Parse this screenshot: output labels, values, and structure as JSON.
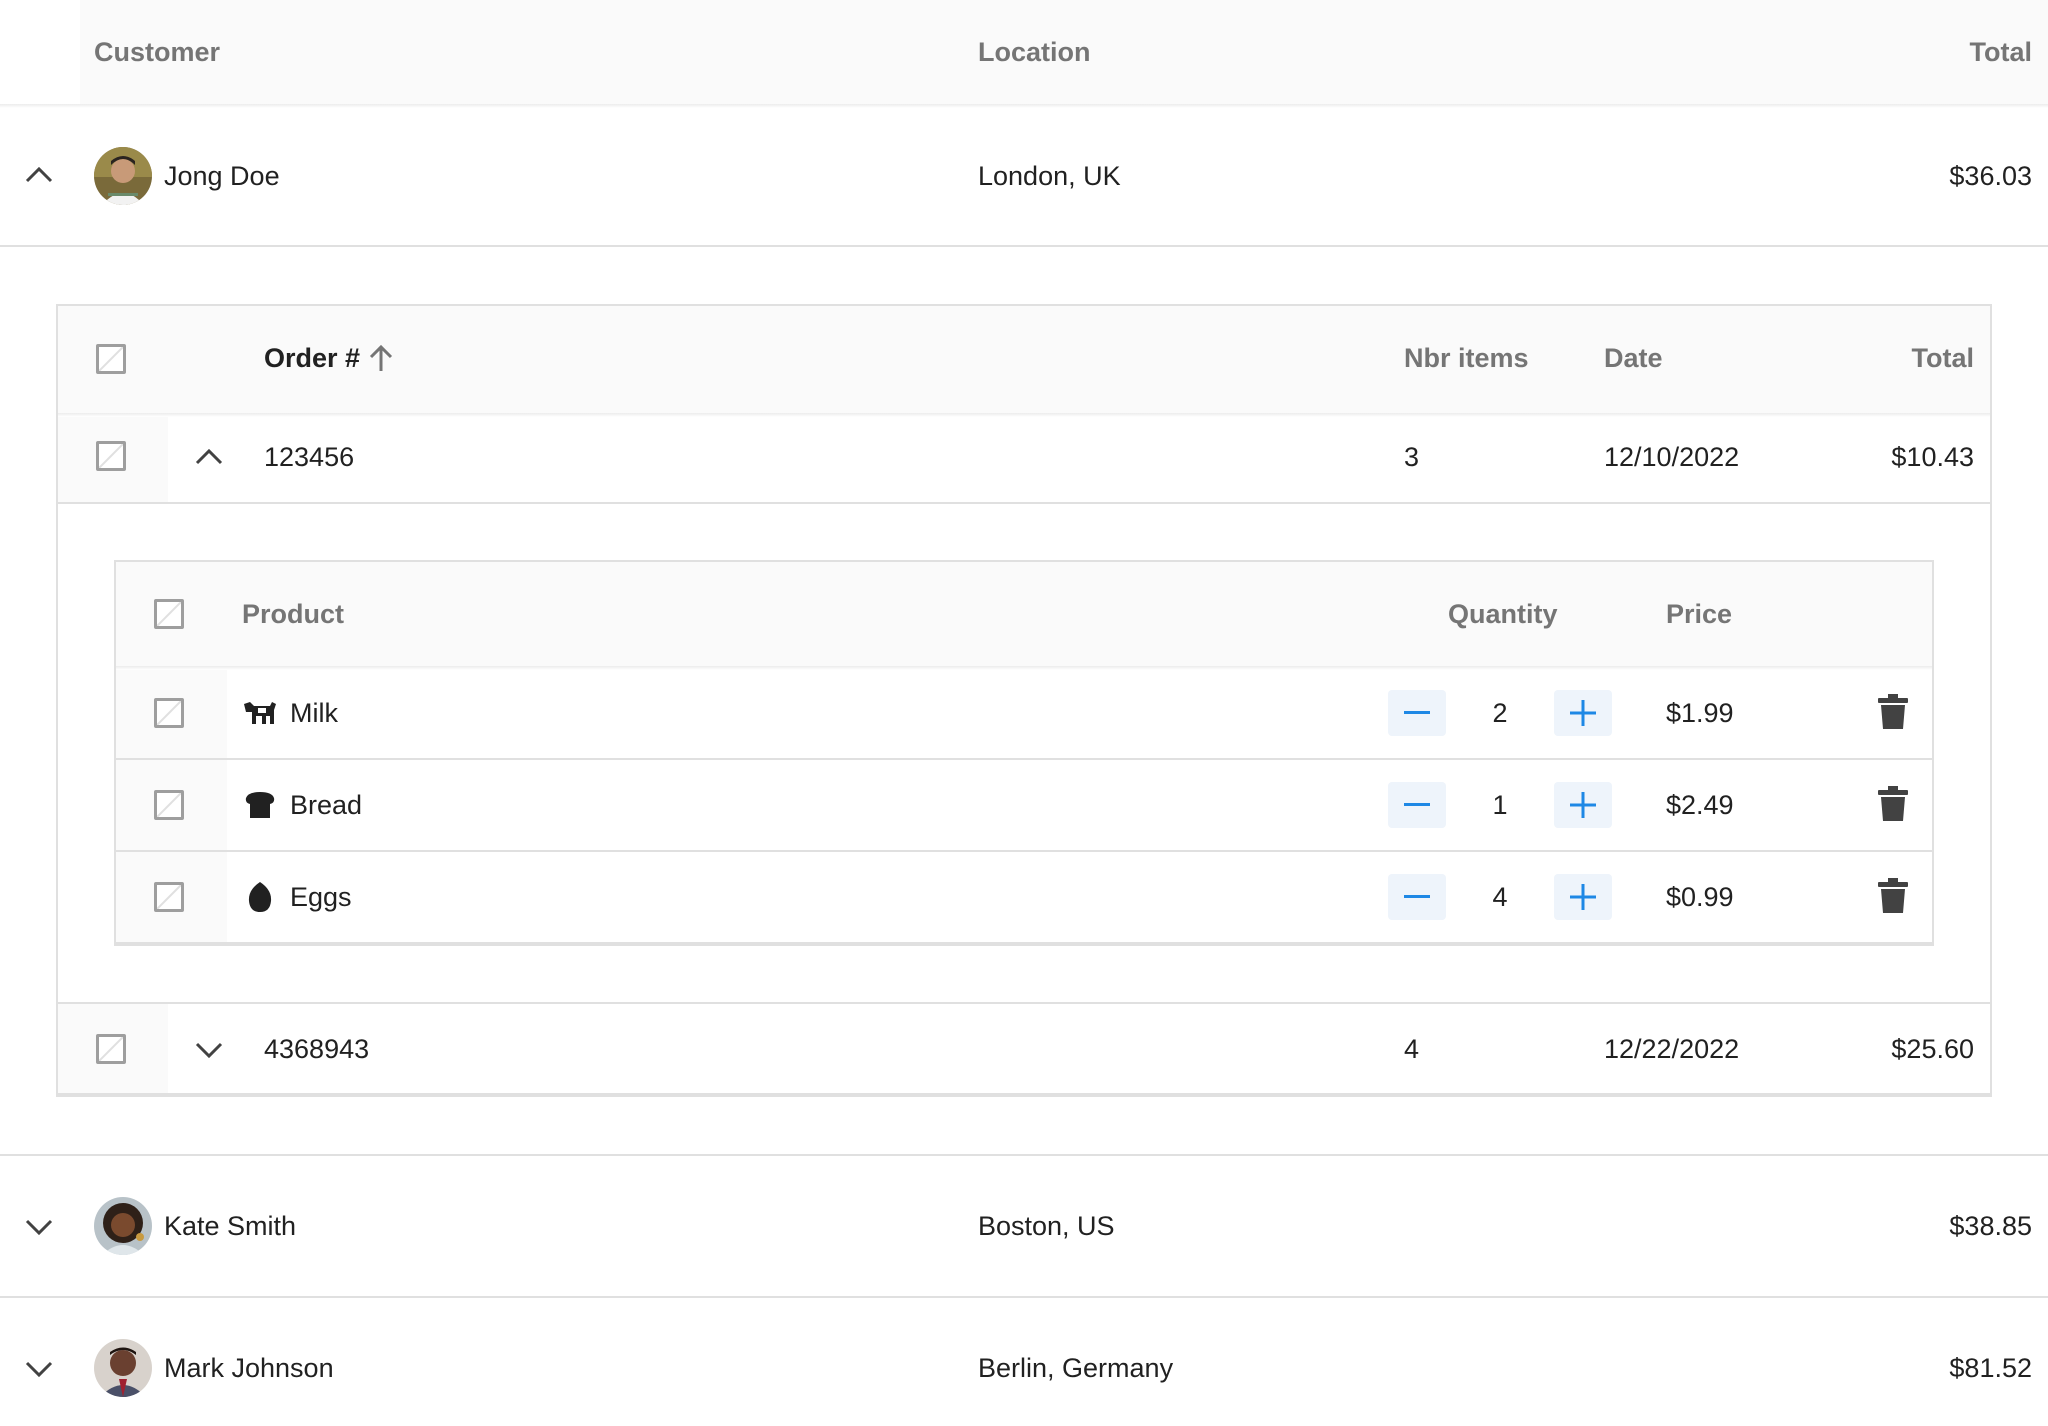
{
  "customers_table": {
    "headers": {
      "customer": "Customer",
      "location": "Location",
      "total": "Total"
    },
    "rows": [
      {
        "name": "Jong Doe",
        "location": "London, UK",
        "total": "$36.03",
        "expanded": true
      },
      {
        "name": "Kate Smith",
        "location": "Boston, US",
        "total": "$38.85",
        "expanded": false
      },
      {
        "name": "Mark Johnson",
        "location": "Berlin, Germany",
        "total": "$81.52",
        "expanded": false
      }
    ]
  },
  "orders_table": {
    "headers": {
      "order": "Order #",
      "items": "Nbr items",
      "date": "Date",
      "total": "Total"
    },
    "sort": "ascending",
    "rows": [
      {
        "order": "123456",
        "items": "3",
        "date": "12/10/2022",
        "total": "$10.43",
        "expanded": true
      },
      {
        "order": "4368943",
        "items": "4",
        "date": "12/22/2022",
        "total": "$25.60",
        "expanded": false
      }
    ]
  },
  "products_table": {
    "headers": {
      "product": "Product",
      "quantity": "Quantity",
      "price": "Price"
    },
    "rows": [
      {
        "icon": "cow-icon",
        "name": "Milk",
        "quantity": "2",
        "price": "$1.99"
      },
      {
        "icon": "bread-icon",
        "name": "Bread",
        "quantity": "1",
        "price": "$2.49"
      },
      {
        "icon": "egg-icon",
        "name": "Eggs",
        "quantity": "4",
        "price": "$0.99"
      }
    ]
  },
  "colors": {
    "header_bg": "#fafafa",
    "border": "#e0e0e0",
    "accent": "#1e88e5",
    "header_text": "#757575"
  }
}
